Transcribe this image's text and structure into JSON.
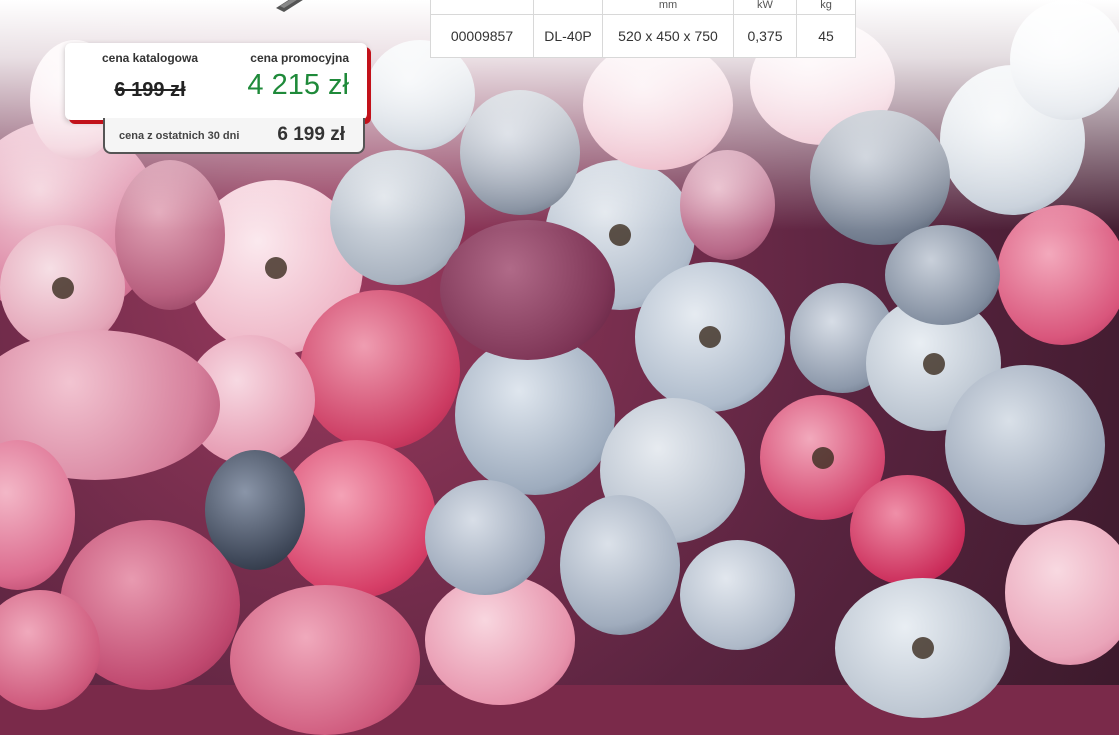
{
  "spec_table": {
    "headers": [
      "",
      "",
      "mm",
      "kW",
      "kg"
    ],
    "row": [
      "00009857",
      "DL-40P",
      "520 x 450 x 750",
      "0,375",
      "45"
    ]
  },
  "price_card": {
    "catalog_label": "cena katalogowa",
    "catalog_price": "6 199 zł",
    "promo_label": "cena promocyjna",
    "promo_price": "4 215 zł",
    "history_label": "cena z ostatnich 30 dni",
    "history_price": "6 199 zł"
  },
  "colors": {
    "promo_green": "#1f8a3a",
    "accent_red": "#c2111a"
  },
  "icons": [
    "product-icon"
  ]
}
